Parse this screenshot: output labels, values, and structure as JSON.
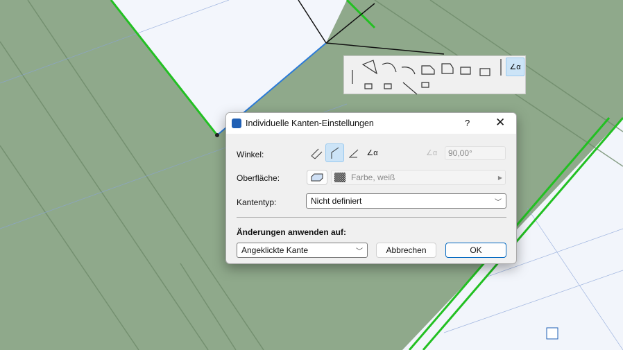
{
  "dialog": {
    "title": "Individuelle Kanten-Einstellungen",
    "help": "?",
    "close": "✕",
    "angle_label": "Winkel:",
    "angle_value": "90,00°",
    "surface_label": "Oberfläche:",
    "surface_value": "Farbe, weiß",
    "edge_type_label": "Kantentyp:",
    "edge_type_value": "Nicht definiert",
    "apply_heading": "Änderungen anwenden auf:",
    "apply_value": "Angeklickte Kante",
    "cancel": "Abbrechen",
    "ok": "OK"
  },
  "colors": {
    "accent": "#0067c0",
    "slab": "#8fa98b",
    "edge_green": "#22c022"
  }
}
